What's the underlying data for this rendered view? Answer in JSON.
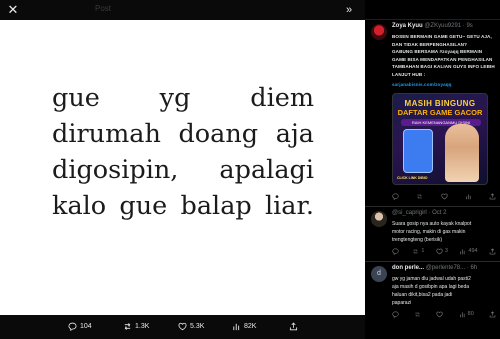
{
  "viewer": {
    "title": "Post",
    "media_lines": [
      "gue yg diem",
      "dirumah doang aja",
      "digosipin, apalagi",
      "kalo gue balap liar."
    ],
    "stats": {
      "replies": "104",
      "reposts": "1.3K",
      "likes": "5.3K",
      "views": "82K"
    }
  },
  "panel": {
    "tweets": [
      {
        "name": "Zoya Kyuu",
        "handle": "@ZKyuu9291 · 9s",
        "lines": [
          "BOSEN BERMAIN GAME GETU~ GETU AJA,",
          "DAN TIDAK BERPENGHASILAN?",
          "GABUNG BERSAMA #zoyaqq BERMAIN",
          "GAME BISA MENDAPATKAN PENGHASILAN",
          "TAMBAHAN BAGI KALIAN GUYS INFO LEBIH",
          "LANJUT HUB :"
        ],
        "link": "sarjanabisnis.com/zoyaqq",
        "ad": {
          "title1": "MASIH BINGUNG",
          "title2": "DAFTAR GAME GACOR",
          "sub": "RAIH KEMENANGANMU DISINI",
          "foot": "CLICK LINK DIBIO"
        },
        "counts": {
          "replies": "",
          "reposts": "",
          "likes": "",
          "views": ""
        }
      },
      {
        "name": "",
        "handle": "@si_caprigirl · Oct 2",
        "lines": [
          "Suara gosip nya auto kayak knalpot",
          "motor racing, makin di gas makin",
          "trengtengteng (berisik)"
        ],
        "counts": {
          "replies": "",
          "reposts": "1",
          "likes": "3",
          "views": "494"
        }
      },
      {
        "name": "don perle...",
        "handle": "@perlente78... · 6h",
        "lines": [
          "gw yg jaman dlu jadwal udah pasti2",
          "aja masih d gosibpin apa lagi beda",
          "haluan dikit,bisa2 pada jadi",
          "paparazi"
        ],
        "counts": {
          "replies": "",
          "reposts": "",
          "likes": "",
          "views": "80"
        }
      }
    ]
  },
  "colors": {
    "accent": "#1d9bf0",
    "text": "#e7e9ea",
    "muted": "#71767b",
    "bg": "#000000"
  }
}
